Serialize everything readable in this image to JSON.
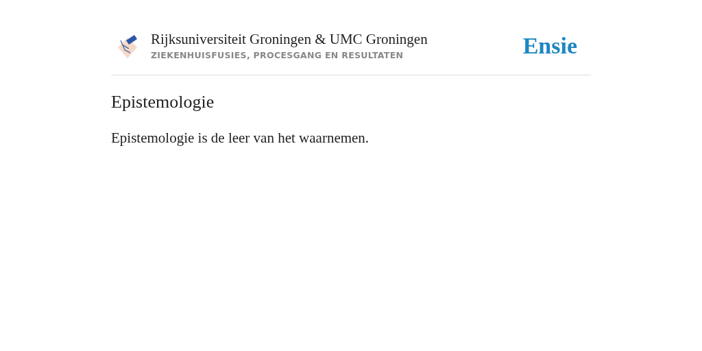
{
  "header": {
    "title": "Rijksuniversiteit Groningen & UMC Groningen",
    "subtitle": "ZIEKENHUISFUSIES, PROCESGANG EN RESULTATEN",
    "brand": "Ensie"
  },
  "article": {
    "heading": "Epistemologie",
    "body": "Epistemologie is de leer van het waarnemen."
  }
}
